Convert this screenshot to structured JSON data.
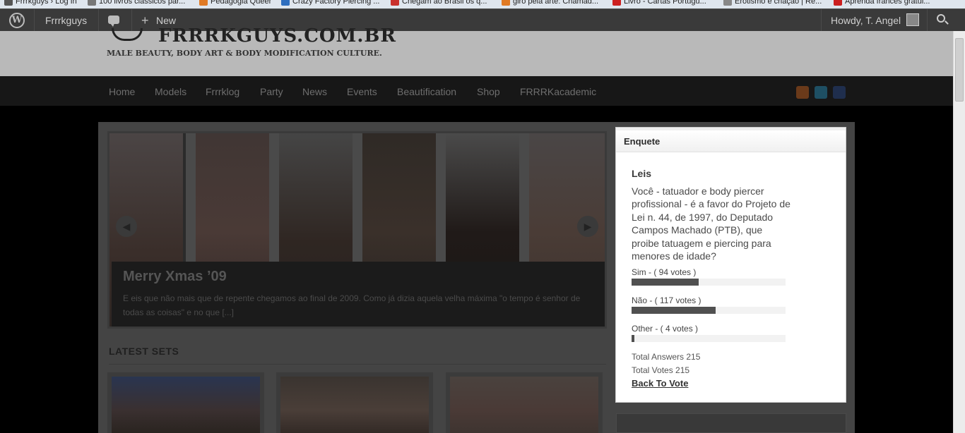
{
  "bookmarks": [
    {
      "label": "Frrrkguys › Log In",
      "color": "#555555"
    },
    {
      "label": "100 livros clássicos par...",
      "color": "#777777"
    },
    {
      "label": "Pedagogia Queer",
      "color": "#e07a24"
    },
    {
      "label": "Crazy Factory Piercing ...",
      "color": "#2f6fbf"
    },
    {
      "label": "Chegam ao Brasil os q...",
      "color": "#c9302c"
    },
    {
      "label": "giro pela arte: Chamad...",
      "color": "#e07a24"
    },
    {
      "label": "Livro - Cartas Portugu...",
      "color": "#cc1f1f"
    },
    {
      "label": "Erotismo e criação | Re...",
      "color": "#888888"
    },
    {
      "label": "Aprenda francês gratui...",
      "color": "#cc1f1f"
    }
  ],
  "admin_bar": {
    "logo_icon": "wordpress-icon",
    "site_name": "Frrrkguys",
    "comments_icon": "comment-bubble-icon",
    "new_label": "New",
    "greeting": "Howdy, T. Angel",
    "search_icon": "search-icon"
  },
  "header": {
    "logo_text": "FRRRKGUYS.COM.BR",
    "tagline": "MALE BEAUTY, BODY ART & BODY MODIFICATION CULTURE."
  },
  "nav": {
    "items": [
      "Home",
      "Models",
      "Frrrklog",
      "Party",
      "News",
      "Events",
      "Beautification",
      "Shop",
      "FRRRKacademic"
    ],
    "social": [
      {
        "name": "rss-icon",
        "color": "#c75a1b"
      },
      {
        "name": "twitter-icon",
        "color": "#2a6f8a"
      },
      {
        "name": "facebook-icon",
        "color": "#2b3f66"
      }
    ]
  },
  "slider": {
    "title": "Merry Xmas ’09",
    "excerpt": "E eis que não mais que de repente chegamos ao final de 2009. Como já dizia aquela velha máxima \"o tempo é senhor de todas as coisas\" e no que [...]",
    "prev_icon": "arrow-left-icon",
    "next_icon": "arrow-right-icon"
  },
  "latest_sets": {
    "heading": "LATEST SETS"
  },
  "poll": {
    "widget_title": "Enquete",
    "title": "Leis",
    "question": "Você - tatuador e body piercer profissional - é a favor do Projeto de Lei n. 44, de 1997, do Deputado Campos Machado (PTB), que proibe tatuagem e piercing para menores de idade?",
    "answers": [
      {
        "label": "Sim - ( 94 votes )",
        "fraction": 0.437
      },
      {
        "label": "Não - ( 117 votes )",
        "fraction": 0.544
      },
      {
        "label": "Other - ( 4 votes )",
        "fraction": 0.019
      }
    ],
    "total_answers": "Total Answers 215",
    "total_votes": "Total Votes 215",
    "back_link": "Back To Vote"
  }
}
